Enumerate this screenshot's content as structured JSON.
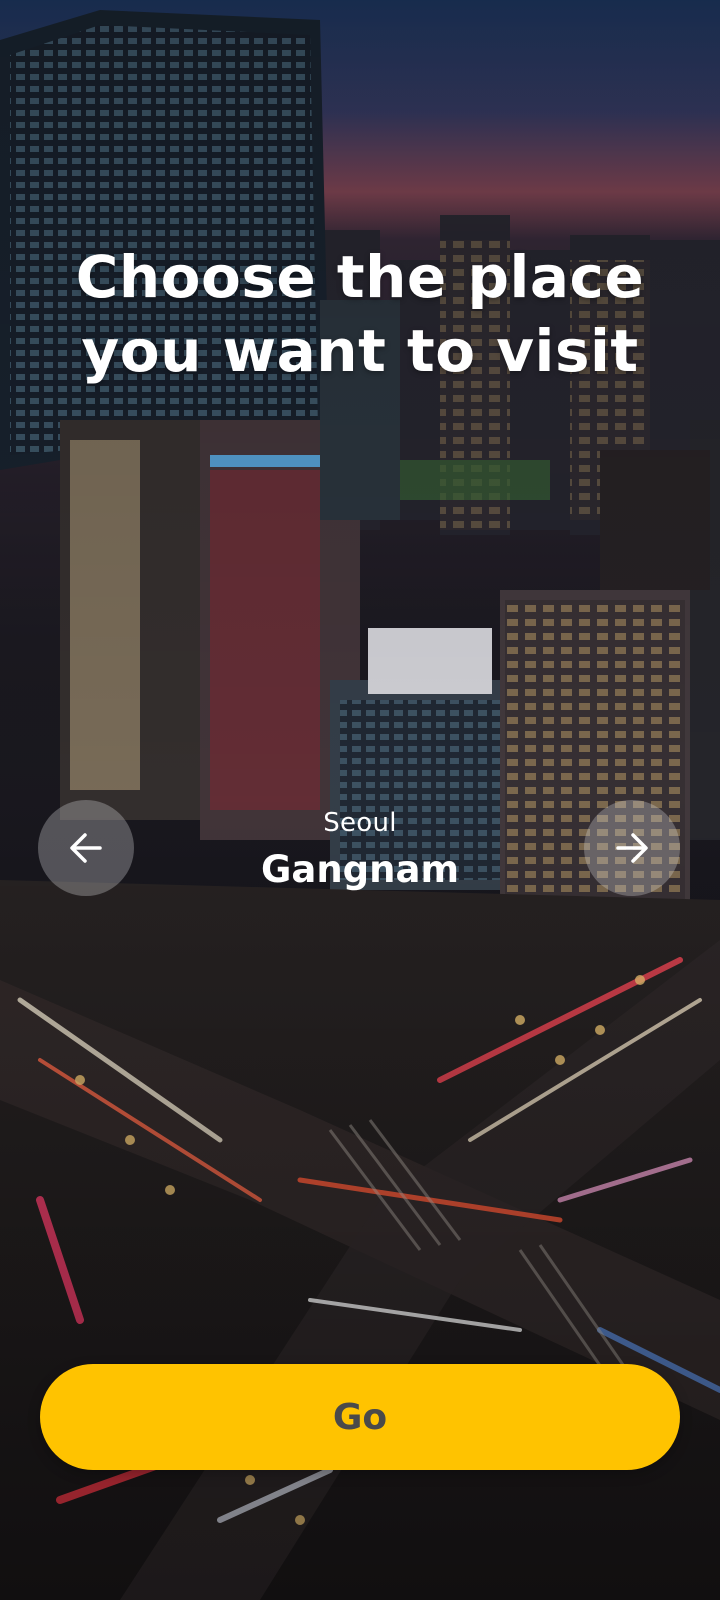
{
  "headline": {
    "line1": "Choose the place",
    "line2": "you want to visit"
  },
  "location": {
    "city": "Seoul",
    "district": "Gangnam"
  },
  "navigation": {
    "prev_icon": "arrow-left-icon",
    "next_icon": "arrow-right-icon"
  },
  "action": {
    "go_label": "Go"
  },
  "colors": {
    "accent": "#ffc300",
    "button_text": "#4a4a4a",
    "headline_text": "#ffffff"
  }
}
